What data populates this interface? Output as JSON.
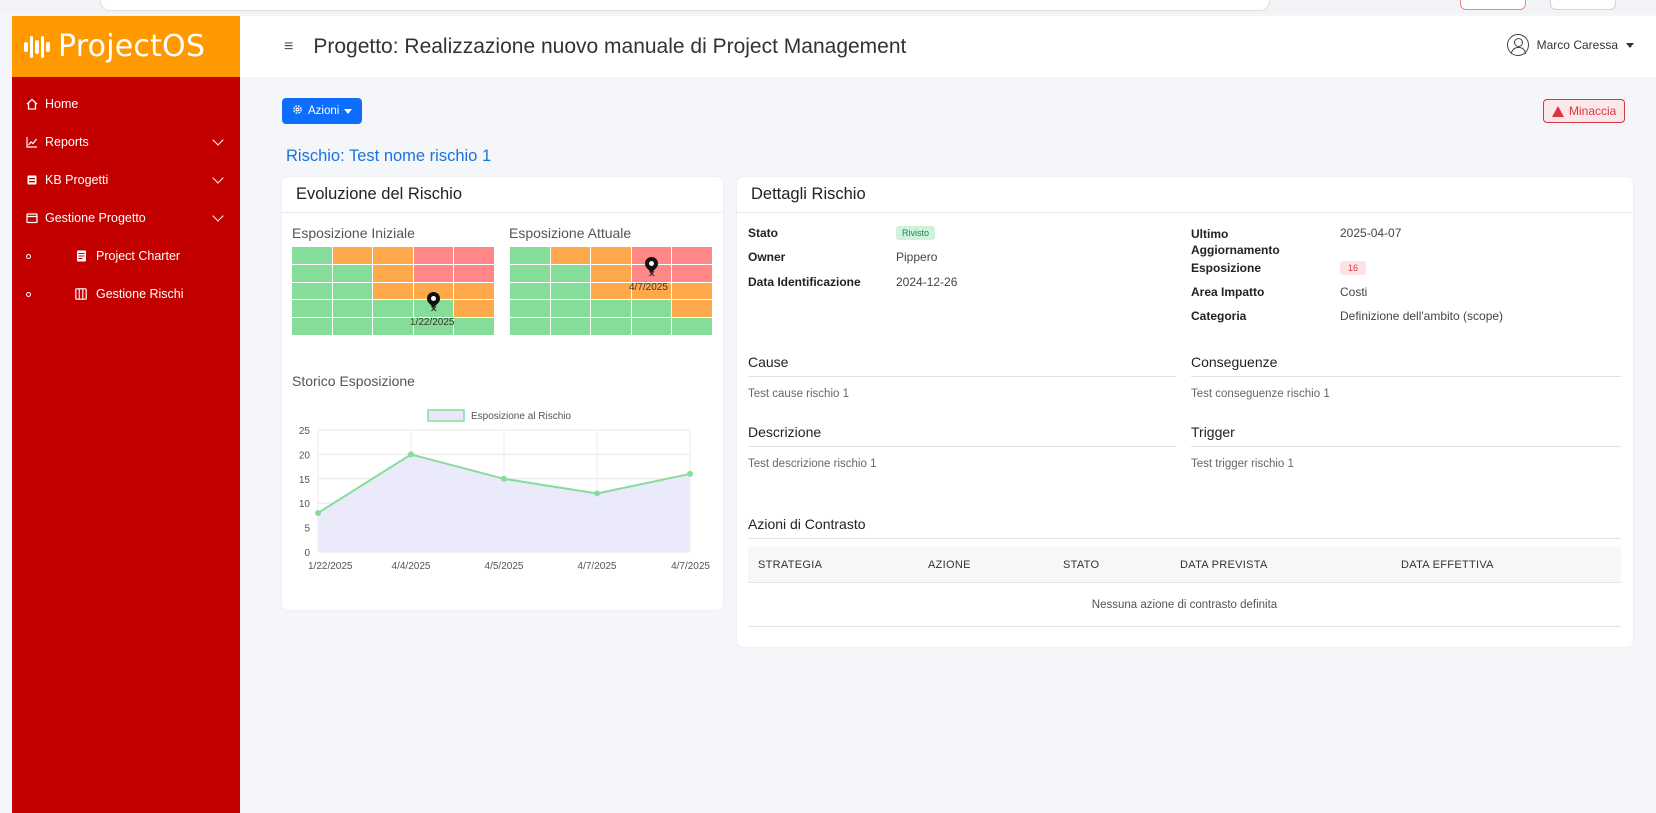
{
  "app": {
    "brand": "ProjectOS"
  },
  "header": {
    "title": "Progetto: Realizzazione nuovo manuale di Project Management",
    "user_name": "Marco Caressa"
  },
  "sidebar": {
    "items": [
      {
        "label": "Home",
        "icon": "home-icon"
      },
      {
        "label": "Reports",
        "icon": "chart-line-icon"
      },
      {
        "label": "KB Progetti",
        "icon": "database-icon"
      },
      {
        "label": "Gestione Progetto",
        "icon": "folder-icon"
      },
      {
        "label": "Project Charter",
        "icon": "document-icon"
      },
      {
        "label": "Gestione Rischi",
        "icon": "kanban-icon"
      }
    ]
  },
  "actions": {
    "azioni_label": "Azioni",
    "minaccia_label": "Minaccia"
  },
  "risk": {
    "title": "Rischio: Test nome rischio 1"
  },
  "evoluzione": {
    "title": "Evoluzione del Rischio",
    "iniziale_title": "Esposizione Iniziale",
    "attuale_title": "Esposizione Attuale",
    "iniziale_marker": "1/22/2025",
    "attuale_marker": "4/7/2025",
    "storico_title": "Storico Esposizione"
  },
  "chart_data": {
    "type": "area",
    "series": [
      {
        "name": "Esposizione al Rischio",
        "values": [
          8,
          20,
          15,
          12,
          16
        ]
      }
    ],
    "categories": [
      "1/22/2025",
      "4/4/2025",
      "4/5/2025",
      "4/7/2025",
      "4/7/2025"
    ],
    "ylim": [
      0,
      25
    ],
    "yticks": [
      0,
      5,
      10,
      15,
      20,
      25
    ],
    "legend": "top",
    "grid": true,
    "line_color": "#86dd9a",
    "fill_color": "#e8e8fa"
  },
  "dettagli": {
    "title": "Dettagli Rischio",
    "stato_label": "Stato",
    "stato_value": "Rivisto",
    "owner_label": "Owner",
    "owner_value": "Pippero",
    "data_id_label": "Data Identificazione",
    "data_id_value": "2024-12-26",
    "ultimo_label": "Ultimo Aggiornamento",
    "ultimo_value": "2025-04-07",
    "esposizione_label": "Esposizione",
    "esposizione_value": "16",
    "area_label": "Area Impatto",
    "area_value": "Costi",
    "categoria_label": "Categoria",
    "categoria_value": "Definizione dell'ambito (scope)",
    "cause_title": "Cause",
    "cause_text": "Test cause rischio 1",
    "conseguenze_title": "Conseguenze",
    "conseguenze_text": "Test conseguenze rischio 1",
    "descrizione_title": "Descrizione",
    "descrizione_text": "Test descrizione rischio 1",
    "trigger_title": "Trigger",
    "trigger_text": "Test trigger rischio 1",
    "azioni_title": "Azioni di Contrasto",
    "table_headers": [
      "STRATEGIA",
      "AZIONE",
      "STATO",
      "DATA PREVISTA",
      "DATA EFFETTIVA"
    ],
    "empty_message": "Nessuna azione di contrasto definita"
  },
  "colors": {
    "sidebar": "#c20000",
    "brand": "#ff9900",
    "primary": "#0d6efd",
    "danger": "#dc3545",
    "green": "#86dd9a",
    "orange": "#ffa94d",
    "red": "#ff8787"
  }
}
